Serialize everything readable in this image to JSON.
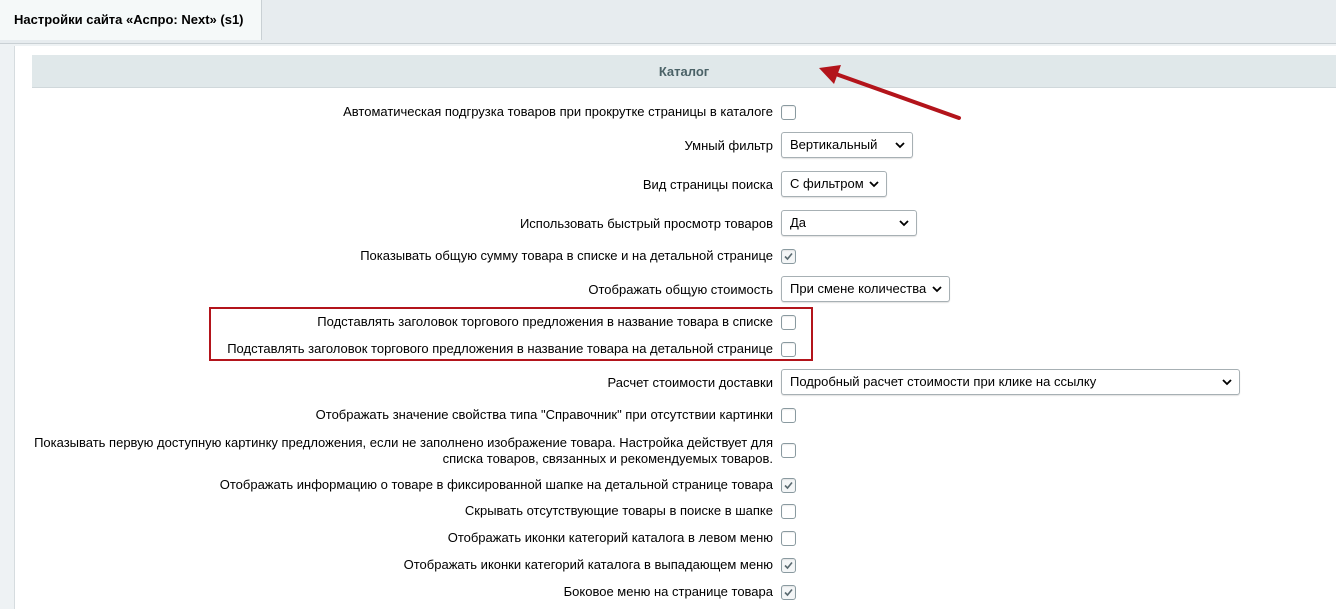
{
  "tab": {
    "title": "Настройки сайта «Аспро: Next» (s1)"
  },
  "section": {
    "title": "Каталог"
  },
  "settings": [
    {
      "label": "Автоматическая подгрузка товаров при прокрутке страницы в каталоге",
      "type": "checkbox",
      "checked": false
    },
    {
      "label": "Умный фильтр",
      "type": "select",
      "value": "Вертикальный"
    },
    {
      "label": "Вид страницы поиска",
      "type": "select",
      "value": "С фильтром"
    },
    {
      "label": "Использовать быстрый просмотр товаров",
      "type": "select",
      "value": "Да"
    },
    {
      "label": "Показывать общую сумму товара в списке и на детальной странице",
      "type": "checkbox",
      "checked": true
    },
    {
      "label": "Отображать общую стоимость",
      "type": "select",
      "value": "При смене количества"
    },
    {
      "label": "Подставлять заголовок торгового предложения в название товара в списке",
      "type": "checkbox",
      "checked": false
    },
    {
      "label": "Подставлять заголовок торгового предложения в название товара на детальной странице",
      "type": "checkbox",
      "checked": false
    },
    {
      "label": "Расчет стоимости доставки",
      "type": "select",
      "value": "Подробный расчет стоимости при клике на ссылку"
    },
    {
      "label": "Отображать значение свойства типа \"Справочник\" при отсутствии картинки",
      "type": "checkbox",
      "checked": false
    },
    {
      "label": "Показывать первую доступную картинку предложения, если не заполнено изображение товара. Настройка действует для списка товаров, связанных и рекомендуемых товаров.",
      "type": "checkbox",
      "checked": false
    },
    {
      "label": "Отображать информацию о товаре в фиксированной шапке на детальной странице товара",
      "type": "checkbox",
      "checked": true
    },
    {
      "label": "Скрывать отсутствующие товары в поиске в шапке",
      "type": "checkbox",
      "checked": false
    },
    {
      "label": "Отображать иконки категорий каталога в левом меню",
      "type": "checkbox",
      "checked": false
    },
    {
      "label": "Отображать иконки категорий каталога в выпадающем меню",
      "type": "checkbox",
      "checked": true
    },
    {
      "label": "Боковое меню на странице товара",
      "type": "checkbox",
      "checked": true
    }
  ],
  "colors": {
    "highlight_border": "#b3141b",
    "arrow": "#b3141b",
    "header_bg": "#e0e8ea"
  }
}
